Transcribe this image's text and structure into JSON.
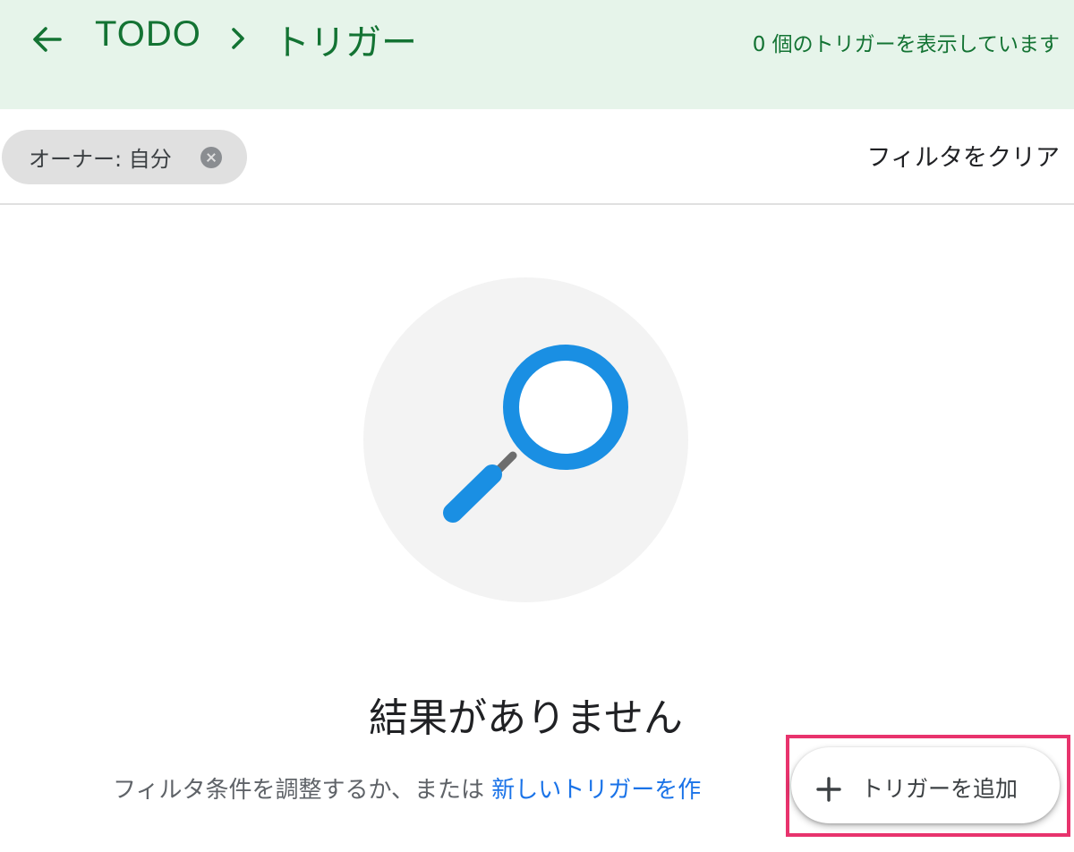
{
  "header": {
    "breadcrumb_root": "TODO",
    "breadcrumb_current": "トリガー",
    "count_text": "0 個のトリガーを表示しています"
  },
  "filters": {
    "chip_label": "オーナー: 自分",
    "clear_label": "フィルタをクリア"
  },
  "empty_state": {
    "title": "結果がありません",
    "hint_text": "フィルタ条件を調整するか、または ",
    "hint_link": "新しいトリガーを作"
  },
  "fab": {
    "label": "トリガーを追加"
  },
  "colors": {
    "header_bg": "#e6f4ea",
    "brand_green": "#137333",
    "link_blue": "#1a73e8",
    "search_icon_blue": "#1a8fe3",
    "highlight_pink": "#e8336d"
  },
  "icons": [
    "back-arrow-icon",
    "chevron-right-icon",
    "close-icon",
    "search-icon",
    "plus-icon"
  ]
}
